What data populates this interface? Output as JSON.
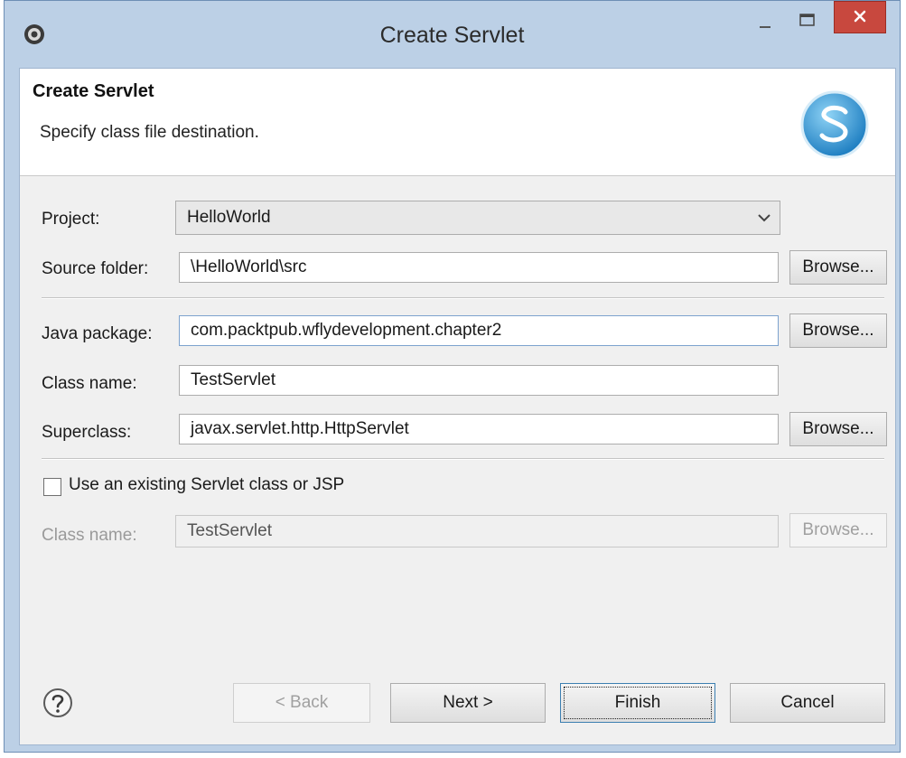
{
  "window": {
    "title": "Create Servlet",
    "icons": {
      "app": "eclipse-gear-icon",
      "minimize": "minimize-icon",
      "maximize": "maximize-icon",
      "close": "close-icon"
    },
    "colors": {
      "close_button": "#c8483e",
      "frame": "#bcd0e6"
    }
  },
  "banner": {
    "title": "Create Servlet",
    "subtitle": "Specify class file destination.",
    "logo_icon": "servlet-s-logo-icon"
  },
  "form": {
    "project": {
      "label": "Project:",
      "value": "HelloWorld"
    },
    "source_folder": {
      "label": "Source folder:",
      "value": "\\HelloWorld\\src",
      "browse": "Browse..."
    },
    "java_package": {
      "label": "Java package:",
      "value": "com.packtpub.wflydevelopment.chapter2",
      "browse": "Browse..."
    },
    "class_name": {
      "label": "Class name:",
      "value": "TestServlet"
    },
    "superclass": {
      "label": "Superclass:",
      "value": "javax.servlet.http.HttpServlet",
      "browse": "Browse..."
    },
    "use_existing": {
      "label": "Use an existing Servlet class or JSP",
      "checked": false
    },
    "existing_class": {
      "label": "Class name:",
      "value": "TestServlet",
      "browse": "Browse...",
      "enabled": false
    }
  },
  "footer": {
    "help_icon": "help-question-icon",
    "back": "< Back",
    "next": "Next >",
    "finish": "Finish",
    "cancel": "Cancel"
  }
}
